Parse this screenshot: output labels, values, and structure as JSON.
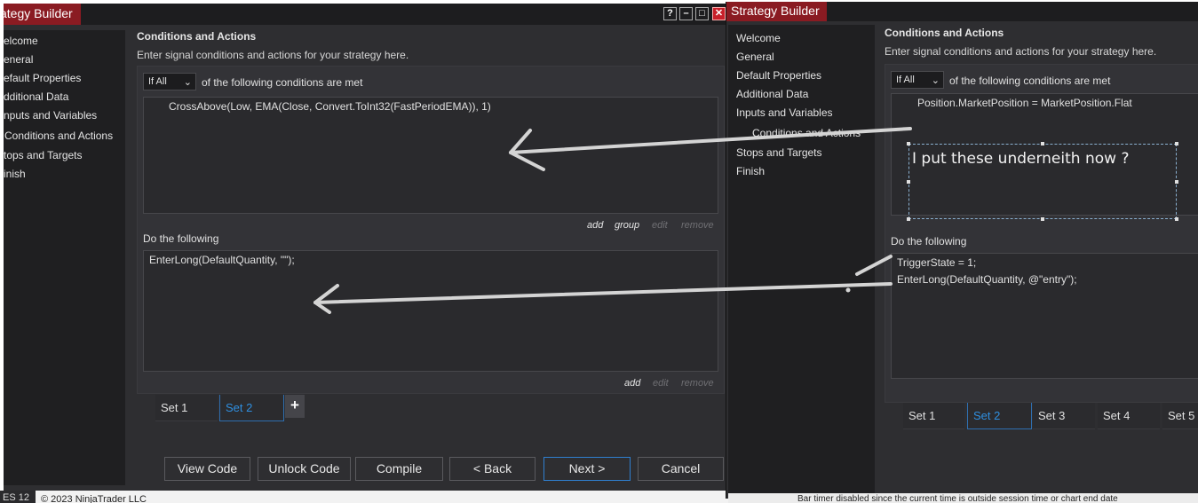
{
  "window1": {
    "title": "ategy Builder",
    "controls": {
      "help": "?",
      "minimize": "–",
      "maximize": "□",
      "close": "✕"
    },
    "nav": [
      "elcome",
      "eneral",
      "efault Properties",
      "dditional Data",
      "nputs and Variables",
      "Conditions and Actions",
      "tops and Targets",
      "inish"
    ],
    "heading": "Conditions and Actions",
    "subheading": "Enter signal conditions and actions for your strategy here.",
    "condition_mode": "If All",
    "condition_suffix": "of the following conditions are met",
    "conditions": [
      "CrossAbove(Low, EMA(Close, Convert.ToInt32(FastPeriodEMA)), 1)"
    ],
    "condition_links": {
      "add": "add",
      "group": "group",
      "edit": "edit",
      "remove": "remove"
    },
    "do_label": "Do the following",
    "actions": [
      "EnterLong(DefaultQuantity, \"\");"
    ],
    "action_links": {
      "add": "add",
      "edit": "edit",
      "remove": "remove"
    },
    "sets": [
      "Set 1",
      "Set 2"
    ],
    "add_set": "+",
    "buttons": {
      "view_code": "View Code",
      "unlock_code": "Unlock Code",
      "compile": "Compile",
      "back": "< Back",
      "next": "Next >",
      "cancel": "Cancel"
    }
  },
  "window2": {
    "title": "Strategy Builder",
    "nav": [
      "Welcome",
      "General",
      "Default Properties",
      "Additional Data",
      "Inputs and Variables",
      "Conditions and Actions",
      "Stops and Targets",
      "Finish"
    ],
    "heading": "Conditions and Actions",
    "subheading": "Enter signal conditions and actions for your strategy here.",
    "condition_mode": "If All",
    "condition_suffix": "of the following conditions are met",
    "conditions": [
      "Position.MarketPosition = MarketPosition.Flat"
    ],
    "annotation": "I put these underneith now ?",
    "do_label": "Do the following",
    "actions": [
      "TriggerState = 1;",
      "EnterLong(DefaultQuantity, @\"entry\");"
    ],
    "sets": [
      "Set 1",
      "Set 2",
      "Set 3",
      "Set 4",
      "Set 5"
    ]
  },
  "status": {
    "left_label": "ES 12",
    "copyright": "© 2023 NinjaTrader LLC",
    "right_text": "Bar timer disabled since the current time is outside session time or chart end date"
  },
  "colors": {
    "accent": "#2f8fe0",
    "title_red": "#8a1b22",
    "panel": "#2e2e31",
    "nav": "#1f1f21"
  }
}
